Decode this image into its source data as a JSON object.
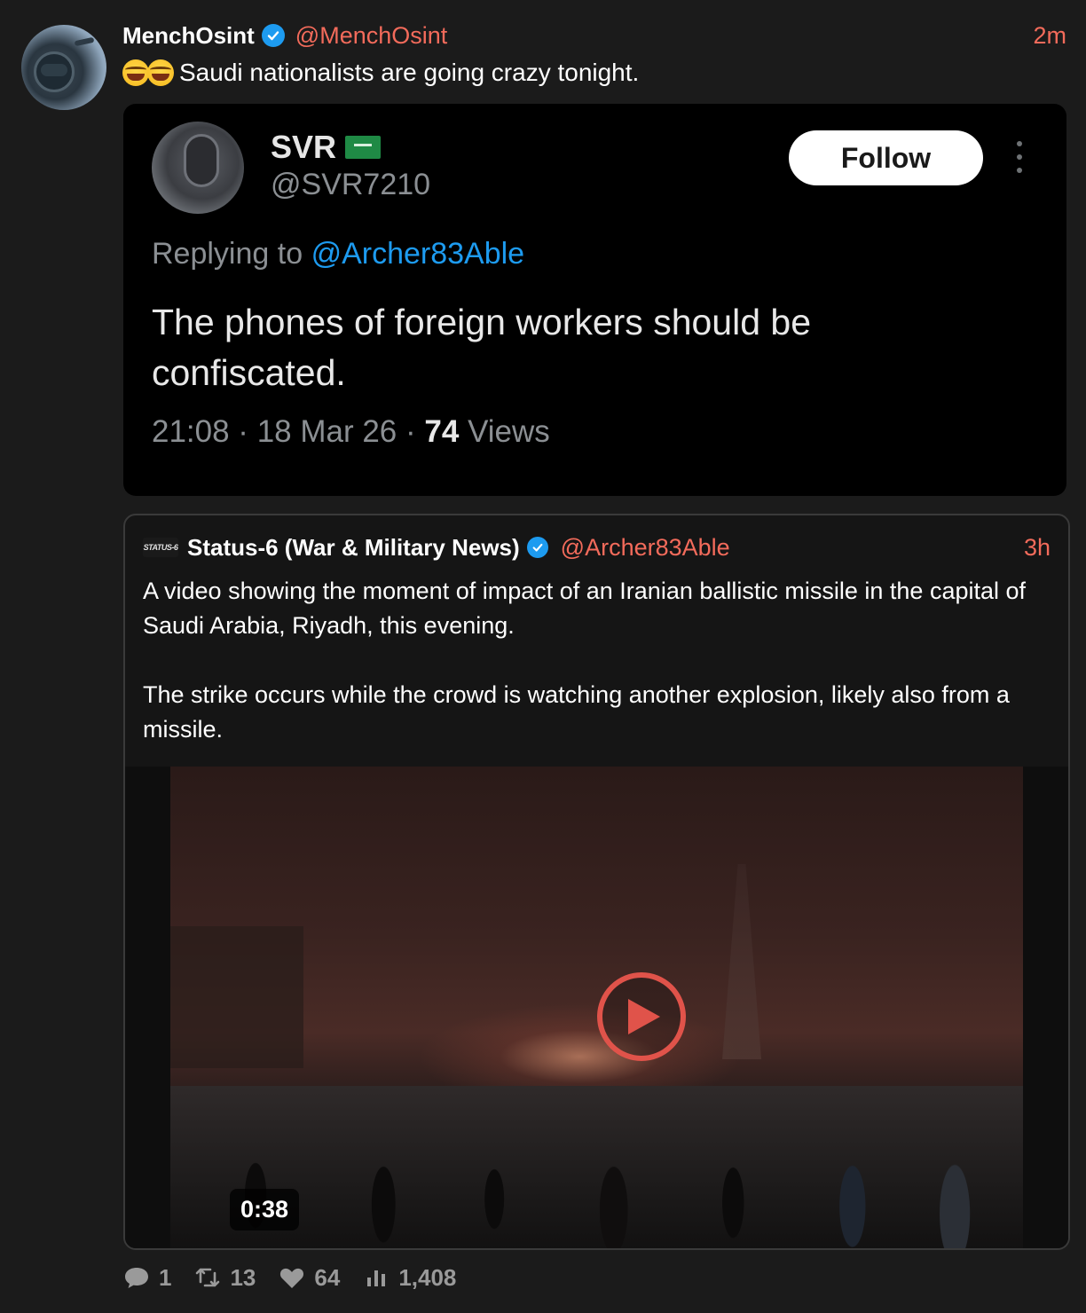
{
  "post": {
    "display_name": "MenchOsint",
    "handle": "@MenchOsint",
    "time": "2m",
    "text": "Saudi nationalists are going crazy tonight.",
    "emoji": "😂😂"
  },
  "embedded_screenshot": {
    "name": "SVR",
    "handle": "@SVR7210",
    "follow_label": "Follow",
    "replying_prefix": "Replying to",
    "replying_mention": "@Archer83Able",
    "text": "The phones of foreign workers should be confiscated.",
    "meta_prefix": "21:08 · 18 Mar 26 ·",
    "views_count": "74",
    "views_label": "Views"
  },
  "quote": {
    "logo_text": "STATUS-6",
    "display_name": "Status-6 (War & Military News)",
    "handle": "@Archer83Able",
    "time": "3h",
    "paragraph_1": "A video showing the moment of impact of an Iranian ballistic missile in the capital of Saudi Arabia, Riyadh, this evening.",
    "paragraph_2": "The strike occurs while the crowd is watching another explosion, likely also from a missile.",
    "video_duration": "0:38"
  },
  "actions": {
    "replies": "1",
    "reposts": "13",
    "likes": "64",
    "views": "1,408"
  },
  "colors": {
    "accent": "#f36b5b",
    "verified": "#1d9bf0",
    "background": "#1b1b1b"
  },
  "icons": [
    "verified-icon",
    "flag-icon",
    "more-icon",
    "play-icon",
    "reply-icon",
    "repost-icon",
    "like-icon",
    "views-icon"
  ]
}
